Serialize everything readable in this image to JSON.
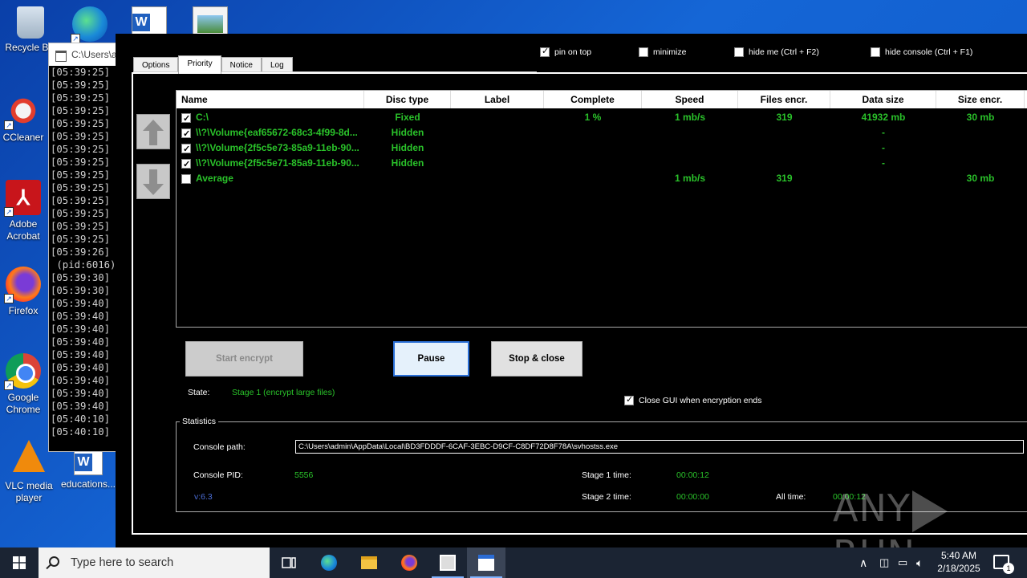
{
  "desktop": {
    "icons": [
      {
        "label": "Recycle Bin",
        "icon": "recycle-bin-icon"
      },
      {
        "label": "",
        "icon": "edge-icon"
      },
      {
        "label": "",
        "icon": "word-doc-icon"
      },
      {
        "label": "",
        "icon": "image-file-icon"
      },
      {
        "label": "CCleaner",
        "icon": "ccleaner-icon"
      },
      {
        "label": "Adobe Acrobat",
        "icon": "acrobat-icon"
      },
      {
        "label": "Firefox",
        "icon": "firefox-icon"
      },
      {
        "label": "Google Chrome",
        "icon": "chrome-icon"
      },
      {
        "label": "VLC media player",
        "icon": "vlc-icon"
      },
      {
        "label": "educations...",
        "icon": "word-doc-icon"
      }
    ]
  },
  "console": {
    "title": "C:\\Users\\a",
    "lines": [
      "[05:39:25]",
      "[05:39:25]",
      "[05:39:25]",
      "[05:39:25]",
      "[05:39:25]",
      "[05:39:25]",
      "[05:39:25]",
      "[05:39:25]",
      "[05:39:25]",
      "[05:39:25]",
      "[05:39:25]",
      "[05:39:25]",
      "[05:39:25]",
      "[05:39:25]",
      "[05:39:26]",
      " (pid:6016)",
      "[05:39:30]",
      "[05:39:30]",
      "[05:39:40]",
      "[05:39:40]",
      "[05:39:40]",
      "[05:39:40]",
      "[05:39:40]",
      "[05:39:40]",
      "[05:39:40]",
      "[05:39:40]",
      "[05:39:40]",
      "[05:40:10]",
      "[05:40:10]"
    ]
  },
  "app": {
    "tabs": [
      "Options",
      "Priority",
      "Notice",
      "Log"
    ],
    "active_tab": "Priority",
    "top_options": [
      {
        "label": "pin on top",
        "checked": true
      },
      {
        "label": "minimize",
        "checked": false
      },
      {
        "label": "hide me (Ctrl + F2)",
        "checked": false
      },
      {
        "label": "hide console (Ctrl + F1)",
        "checked": false
      }
    ],
    "table": {
      "headers": [
        "Name",
        "Disc type",
        "Label",
        "Complete",
        "Speed",
        "Files encr.",
        "Data size",
        "Size encr."
      ],
      "rows": [
        {
          "checked": true,
          "name": "C:\\",
          "disc": "Fixed",
          "label": "",
          "complete": "1 %",
          "speed": "1 mb/s",
          "files": "319",
          "data": "41932 mb",
          "size": "30 mb"
        },
        {
          "checked": true,
          "name": "\\\\?\\Volume{eaf65672-68c3-4f99-8d...",
          "disc": "Hidden",
          "label": "",
          "complete": "",
          "speed": "",
          "files": "",
          "data": "-",
          "size": ""
        },
        {
          "checked": true,
          "name": "\\\\?\\Volume{2f5c5e73-85a9-11eb-90...",
          "disc": "Hidden",
          "label": "",
          "complete": "",
          "speed": "",
          "files": "",
          "data": "-",
          "size": ""
        },
        {
          "checked": true,
          "name": "\\\\?\\Volume{2f5c5e71-85a9-11eb-90...",
          "disc": "Hidden",
          "label": "",
          "complete": "",
          "speed": "",
          "files": "",
          "data": "-",
          "size": ""
        },
        {
          "checked": false,
          "name": "Average",
          "disc": "",
          "label": "",
          "complete": "",
          "speed": "1 mb/s",
          "files": "319",
          "data": "",
          "size": "30 mb"
        }
      ]
    },
    "buttons": {
      "start": "Start encrypt",
      "pause": "Pause",
      "stop": "Stop & close"
    },
    "state_label": "State:",
    "state_value": "Stage 1 (encrypt large files)",
    "close_gui": {
      "label": "Close GUI when encryption ends",
      "checked": true
    },
    "stats": {
      "legend": "Statistics",
      "console_path_label": "Console path:",
      "console_path": "C:\\Users\\admin\\AppData\\Local\\BD3FDDDF-6CAF-3EBC-D9CF-C8DF72D8F78A\\svhostss.exe",
      "pid_label": "Console PID:",
      "pid": "5556",
      "stage1_label": "Stage 1 time:",
      "stage1": "00:00:12",
      "stage2_label": "Stage 2 time:",
      "stage2": "00:00:00",
      "all_label": "All time:",
      "all": "00:00:12",
      "version": "v:6.3"
    }
  },
  "watermark": {
    "left": "ANY",
    "right": "RUN"
  },
  "taskbar": {
    "search_placeholder": "Type here to search",
    "time": "5:40 AM",
    "date": "2/18/2025",
    "notification_count": "1"
  },
  "colors": {
    "accent_green": "#2ac22a",
    "focus_blue": "#2a6fd6",
    "taskbar": "#1b2433"
  }
}
